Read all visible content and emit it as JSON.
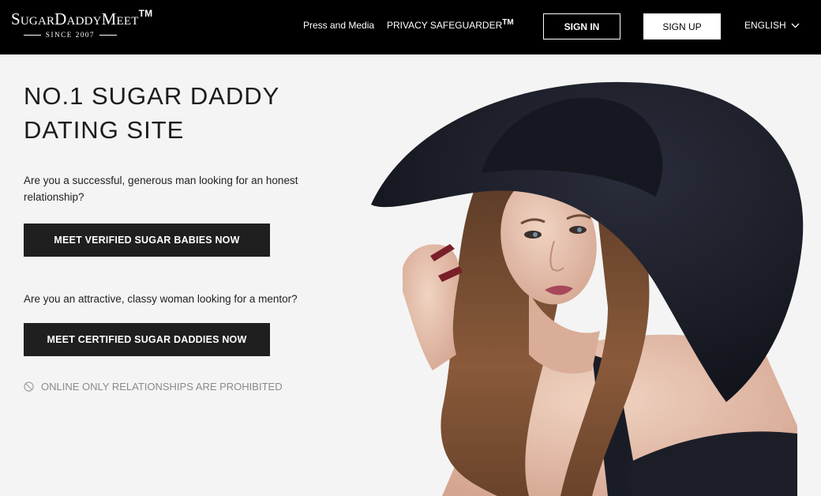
{
  "header": {
    "logo_text": "SugarDaddyMeet",
    "logo_tm": "TM",
    "logo_since": "SINCE 2007",
    "nav_press": "Press and Media",
    "nav_privacy": "PRIVACY SAFEGUARDER",
    "nav_privacy_tm": "TM",
    "signin_label": "SIGN IN",
    "signup_label": "SIGN UP",
    "language": "ENGLISH"
  },
  "hero": {
    "title_line1": "NO.1 SUGAR DADDY",
    "title_line2": "DATING SITE",
    "question_men": "Are you a successful, generous man looking for an honest relationship?",
    "cta_men": "MEET VERIFIED SUGAR BABIES NOW",
    "question_women": "Are you an attractive, classy woman looking for a mentor?",
    "cta_women": "MEET CERTIFIED SUGAR DADDIES NOW",
    "notice": "ONLINE ONLY RELATIONSHIPS ARE PROHIBITED"
  },
  "icons": {
    "language_dropdown": "chevron-down-icon",
    "notice": "prohibited-icon"
  },
  "colors": {
    "header_bg": "#000000",
    "page_bg": "#f4f4f4",
    "cta_bg": "#1f1f1f",
    "notice_text": "#8a8a8a"
  }
}
